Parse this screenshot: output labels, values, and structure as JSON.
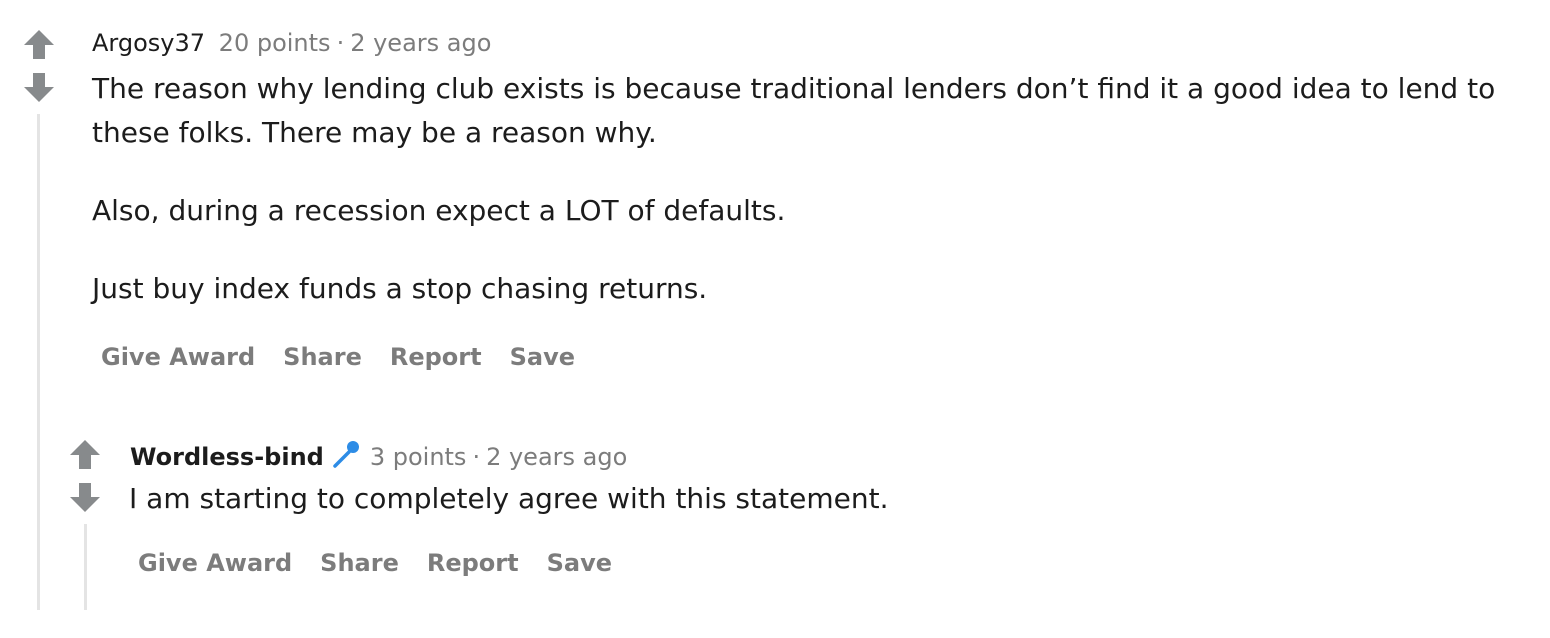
{
  "comments": [
    {
      "author": "Argosy37",
      "points": "20 points",
      "separator": "·",
      "age": "2 years ago",
      "paragraphs": [
        "The reason why lending club exists is because traditional lenders don’t find it a good idea to lend to these folks. There may be a reason why.",
        "Also, during a recession expect a LOT of defaults.",
        "Just buy index funds a stop chasing returns."
      ],
      "actions": [
        "Give Award",
        "Share",
        "Report",
        "Save"
      ]
    },
    {
      "author": "Wordless-bind",
      "flair_icon": "microphone-icon",
      "points": "3 points",
      "separator": "·",
      "age": "2 years ago",
      "paragraphs": [
        "I am starting to completely agree with this statement."
      ],
      "actions": [
        "Give Award",
        "Share",
        "Report",
        "Save"
      ]
    }
  ],
  "colors": {
    "arrow": "#878a8c",
    "meta_text": "#7c7c7c",
    "body_text": "#1c1c1c",
    "thread_line": "#e4e4e4",
    "flair_blue": "#2d8ce6"
  }
}
